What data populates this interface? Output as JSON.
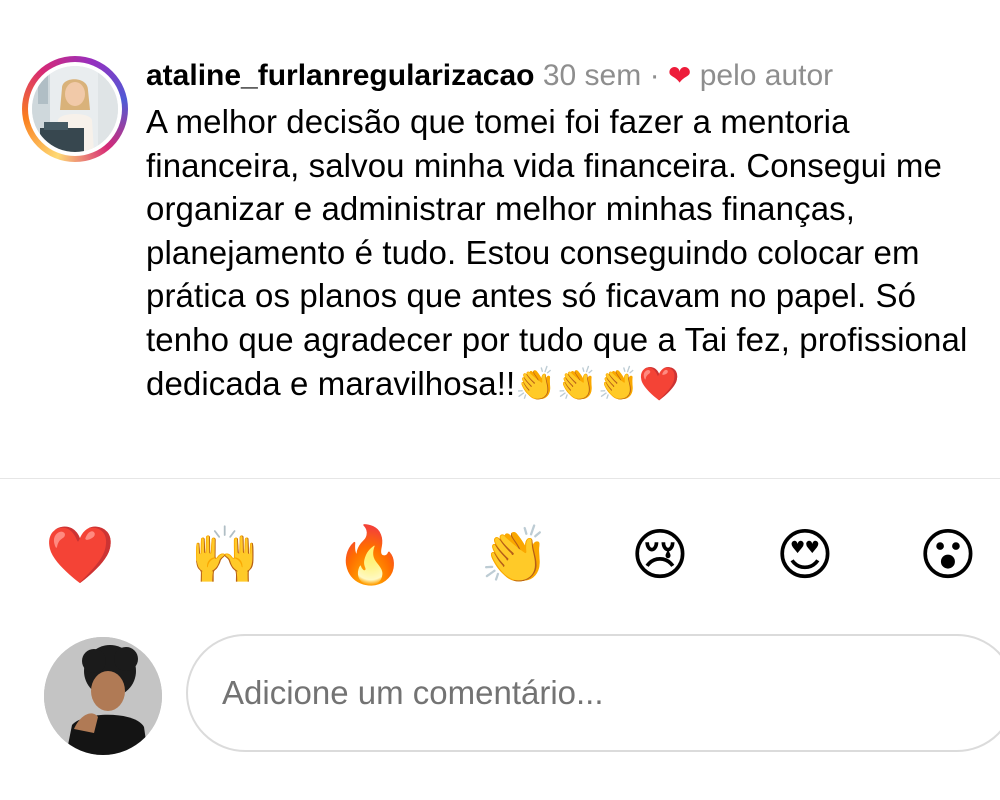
{
  "comment": {
    "username": "ataline_furlanregularizacao",
    "time_ago": "30 sem",
    "separator": "·",
    "liked_by_label": "pelo autor",
    "text": "A melhor decisão que tomei foi fazer a mentoria financeira, salvou minha vida financeira. Consegui me organizar e administrar melhor minhas finanças, planejamento é tudo. Estou conseguindo colocar em prática os planos que antes só ficavam no papel. Só tenho que agradecer por tudo que a Tai fez, profissional dedicada e maravilhosa!!👏👏👏❤️"
  },
  "reactions": [
    {
      "emoji": "❤️",
      "icon": "red-heart-icon"
    },
    {
      "emoji": "🙌",
      "icon": "raising-hands-icon"
    },
    {
      "emoji": "🔥",
      "icon": "fire-icon"
    },
    {
      "emoji": "👏",
      "icon": "clapping-hands-icon"
    },
    {
      "emoji": "😢",
      "icon": "crying-face-icon"
    },
    {
      "emoji": "😍",
      "icon": "heart-eyes-icon"
    },
    {
      "emoji": "😮",
      "icon": "surprised-face-icon"
    }
  ],
  "composer": {
    "placeholder": "Adicione um comentário..."
  },
  "colors": {
    "heart": "#ed1c3a",
    "muted_text": "#8e8e8e",
    "story_ring": [
      "#feda75",
      "#fa7e1e",
      "#d62976",
      "#962fbf",
      "#4f5bd5"
    ],
    "input_border": "#dbdbdb"
  }
}
